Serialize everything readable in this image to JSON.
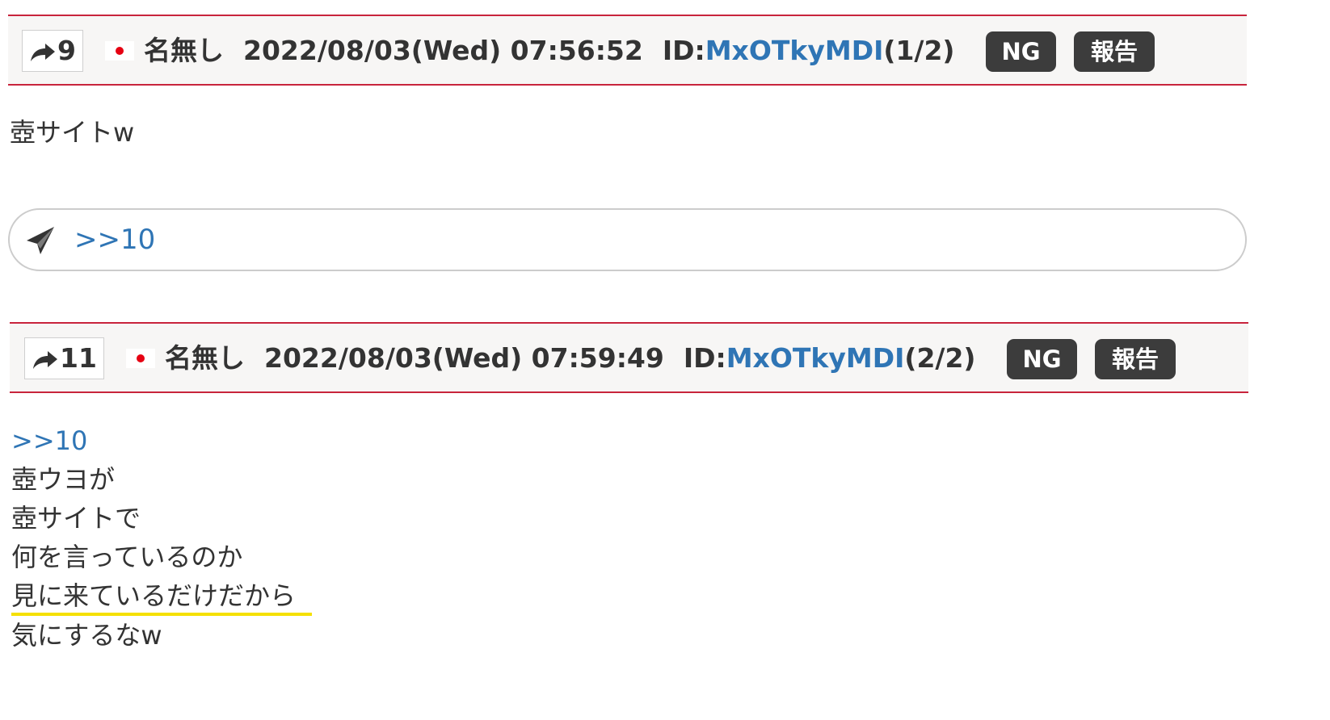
{
  "posts": [
    {
      "number": "9",
      "name": "名無し",
      "datetime": "2022/08/03(Wed) 07:56:52",
      "id_label": "ID:",
      "id_value": "MxOTkyMDI",
      "id_count": "(1/2)",
      "ng_label": "NG",
      "report_label": "報告",
      "body_lines": [
        "壺サイトw"
      ]
    },
    {
      "number": "11",
      "name": "名無し",
      "datetime": "2022/08/03(Wed) 07:59:49",
      "id_label": "ID:",
      "id_value": "MxOTkyMDI",
      "id_count": "(2/2)",
      "ng_label": "NG",
      "report_label": "報告",
      "quote": ">>10",
      "body_lines": [
        "壺ウヨが",
        "壺サイトで",
        "何を言っているのか",
        "見に来ているだけだから",
        "気にするなw"
      ]
    }
  ],
  "reply_box": {
    "icon": "send-icon",
    "link_text": ">>10"
  },
  "colors": {
    "header_border": "#c8243c",
    "link": "#2f75b5",
    "button_bg": "#3c3c3c",
    "highlight_underline": "#f5e000",
    "flag_red": "#e60012"
  },
  "icons": [
    "share-arrow-icon",
    "japan-flag-icon",
    "send-icon"
  ]
}
